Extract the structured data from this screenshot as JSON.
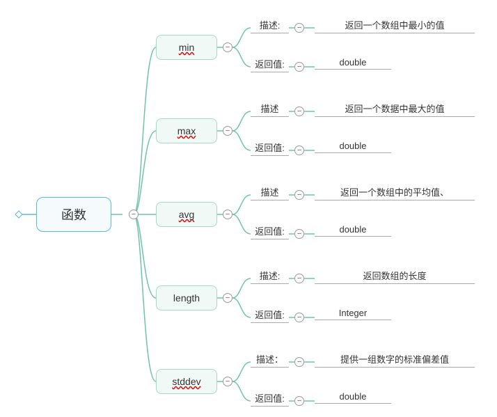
{
  "root": {
    "label": "函数"
  },
  "functions": [
    {
      "name": "min",
      "desc_label": "描述:",
      "desc_value": "返回一个数组中最小的值",
      "ret_label": "返回值:",
      "ret_value": "double",
      "wavy": true
    },
    {
      "name": "max",
      "desc_label": "描述",
      "desc_value": "返回一个数据中最大的值",
      "ret_label": "返回值:",
      "ret_value": "double",
      "wavy": true
    },
    {
      "name": "avg",
      "desc_label": "描述",
      "desc_value": "返回一个数组中的平均值、",
      "ret_label": "返回值:",
      "ret_value": "double",
      "wavy": true
    },
    {
      "name": "length",
      "desc_label": "描述:",
      "desc_value": "返回数组的长度",
      "ret_label": "返回值:",
      "ret_value": "Integer",
      "wavy": false
    },
    {
      "name": "stddev",
      "desc_label": "描述：",
      "desc_value": "提供一组数字的标准偏差值",
      "ret_label": "返回值:",
      "ret_value": "double",
      "wavy": true
    }
  ]
}
